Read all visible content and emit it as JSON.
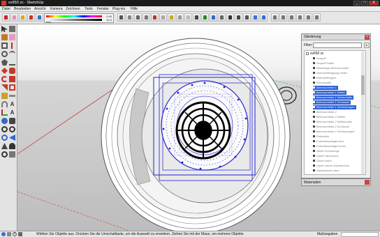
{
  "window": {
    "title": "sv650 zc - SketchUp",
    "controls": [
      "_",
      "□",
      "X"
    ]
  },
  "menu": [
    "Datei",
    "Bearbeiten",
    "Ansicht",
    "Kamera",
    "Zeichnen",
    "Tools",
    "Fenster",
    "Plug-ins",
    "Hilfe"
  ],
  "color_panel": {
    "value_top": "0.40",
    "value_bottom": "10.0",
    "label": "Wert"
  },
  "outliner": {
    "title": "Gliederung",
    "filter_label": "Filter:",
    "filter_value": "",
    "root": "sv650 zc",
    "items": [
      {
        "label": "Auspuff",
        "selected": false
      },
      {
        "label": "Auspuff Halter",
        "selected": false
      },
      {
        "label": "Bildvorlage Bremsscheibe",
        "selected": false
      },
      {
        "label": "Bremsbefestigung hinten",
        "selected": false
      },
      {
        "label": "Bremsleitungen",
        "selected": false
      },
      {
        "label": "Bremssattel",
        "selected": false
      },
      {
        "label": "Bremsscheibe 1",
        "selected": true
      },
      {
        "label": "Bremsscheibe 1 Nieten",
        "selected": true
      },
      {
        "label": "Bremsscheibe 1 Nietenhalter",
        "selected": true
      },
      {
        "label": "Bremsscheibe 1 Schraube",
        "selected": true
      },
      {
        "label": "Bremsscheibe 1 Verbindungen",
        "selected": true
      },
      {
        "label": "Bremsscheibe 2",
        "selected": false
      },
      {
        "label": "Bremsscheibe 2 Nieten",
        "selected": false
      },
      {
        "label": "Bremsscheibe 2 Nietenhalter",
        "selected": false
      },
      {
        "label": "Bremsscheibe 2 Schraube",
        "selected": false
      },
      {
        "label": "Bremsscheibe 2 Verbindungen",
        "selected": false
      },
      {
        "label": "Federbein",
        "selected": false
      },
      {
        "label": "Fußrastenanlage links",
        "selected": false
      },
      {
        "label": "Fußrastenanlage rechts",
        "selected": false
      },
      {
        "label": "Gabel Schutzringe",
        "selected": false
      },
      {
        "label": "Gabel Tauchrohre",
        "selected": false
      },
      {
        "label": "Gabel unten",
        "selected": false
      },
      {
        "label": "Gabel untere Gabelbrücke",
        "selected": false
      },
      {
        "label": "Gabelbrücke oben",
        "selected": false
      }
    ]
  },
  "materials": {
    "title": "Materialien"
  },
  "status": {
    "hint": "Wählen Sie Objekte aus. Drücken Sie die Umschalttaste, um die Auswahl zu erweitern. Ziehen Sie mit der Maus, um mehrere Objekte",
    "measure_label": "Maßangaben",
    "measure_value": ""
  },
  "colors": {
    "selection": "#2c5fd6",
    "model_blue": "#1f1fd8",
    "axis_red": "#cc2222",
    "axis_green": "#22aa22"
  }
}
